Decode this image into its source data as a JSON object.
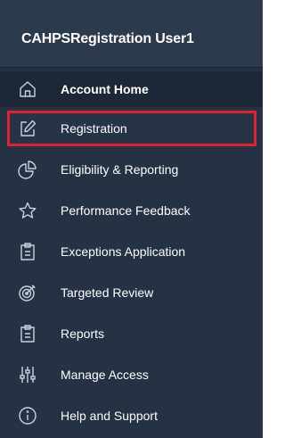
{
  "sidebar": {
    "user_name": "CAHPSRegistration User1",
    "items": [
      {
        "label": "Account Home",
        "icon": "home-icon",
        "active": true
      },
      {
        "label": "Registration",
        "icon": "edit-icon",
        "selected": true
      },
      {
        "label": "Eligibility & Reporting",
        "icon": "pie-chart-icon"
      },
      {
        "label": "Performance Feedback",
        "icon": "star-icon"
      },
      {
        "label": "Exceptions Application",
        "icon": "clipboard-icon"
      },
      {
        "label": "Targeted Review",
        "icon": "target-icon"
      },
      {
        "label": "Reports",
        "icon": "report-icon"
      },
      {
        "label": "Manage Access",
        "icon": "sliders-icon"
      },
      {
        "label": "Help and Support",
        "icon": "info-icon"
      }
    ]
  },
  "colors": {
    "sidebar_bg": "#243244",
    "header_bg": "#2b3a4d",
    "highlight_border": "#e5202a",
    "icon_stroke": "#c9d2de"
  }
}
